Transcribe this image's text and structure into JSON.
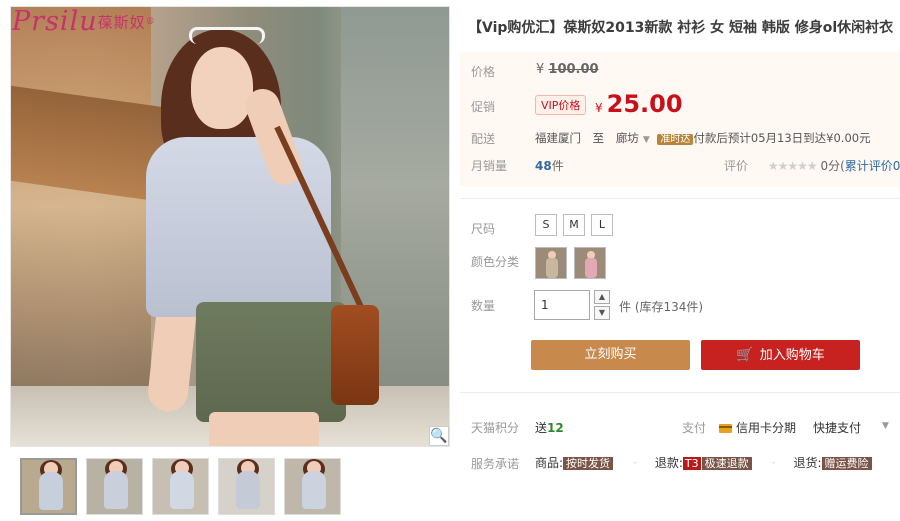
{
  "product": {
    "title": "【Vip购优汇】葆斯奴2013新款 衬衫 女 短袖 韩版 修身ol休闲衬衣"
  },
  "brand": {
    "logo_text": "Prsilu",
    "logo_cn": "葆斯奴",
    "logo_reg": "®"
  },
  "gallery": {
    "zoom_icon": "🔍",
    "thumbnails": [
      {
        "name": "thumb-1",
        "shirt": "#c7cedc",
        "bg": "#b9a98f"
      },
      {
        "name": "thumb-2",
        "shirt": "#c9cfdb",
        "bg": "#b8b2a5"
      },
      {
        "name": "thumb-3",
        "shirt": "#d1d7e3",
        "bg": "#c6bfb2"
      },
      {
        "name": "thumb-4",
        "shirt": "#c4cad6",
        "bg": "#d7d2c9"
      },
      {
        "name": "thumb-5",
        "shirt": "#ccd2de",
        "bg": "#bfb7a9"
      }
    ]
  },
  "pricing": {
    "price_label": "价格",
    "old_currency": "¥",
    "old_value": "100.00",
    "promo_label": "促销",
    "vip_badge": "VIP价格",
    "new_currency": "¥",
    "new_value": "25.00"
  },
  "shipping": {
    "label": "配送",
    "from": "福建厦门",
    "to_word": "至",
    "dest": "廊坊",
    "caret": "▼",
    "badge": "准时达",
    "text": "付款后预计05月13日到达¥0.00元"
  },
  "sales": {
    "label": "月销量",
    "count": "48",
    "unit": "件",
    "rating_label": "评价",
    "stars": "★★★★★",
    "score": "0分",
    "review_open": "(",
    "review_link": "累计评价0"
  },
  "options": {
    "size_label": "尺码",
    "sizes": [
      "S",
      "M",
      "L"
    ],
    "color_label": "颜色分类",
    "colors": [
      {
        "name": "color-1",
        "shirt": "#c9b69e"
      },
      {
        "name": "color-2",
        "shirt": "#e2a9b4"
      }
    ],
    "qty_label": "数量",
    "qty_value": "1",
    "qty_up": "▲",
    "qty_down": "▼",
    "stock_text": "件 (库存134件)"
  },
  "actions": {
    "buy_now": "立刻购买",
    "add_to_cart": "加入购物车",
    "cart_icon": "🛒",
    "buy_color": "#c8894c",
    "cart_color": "#c7221f"
  },
  "services": {
    "points_label": "天猫积分",
    "points_prefix": "送",
    "points_value": "12",
    "pay_label": "支付",
    "pay_card": "信用卡分期",
    "pay_fast": "快捷支付",
    "pay_caret": "▼",
    "promise_label": "服务承诺",
    "promise_items": [
      {
        "prefix": "商品:",
        "tag": "按时发货"
      },
      {
        "prefix": "退款:",
        "tag_red": "T3",
        "tag": "极速退款"
      },
      {
        "prefix": "退货:",
        "tag": "赠运费险"
      }
    ]
  }
}
